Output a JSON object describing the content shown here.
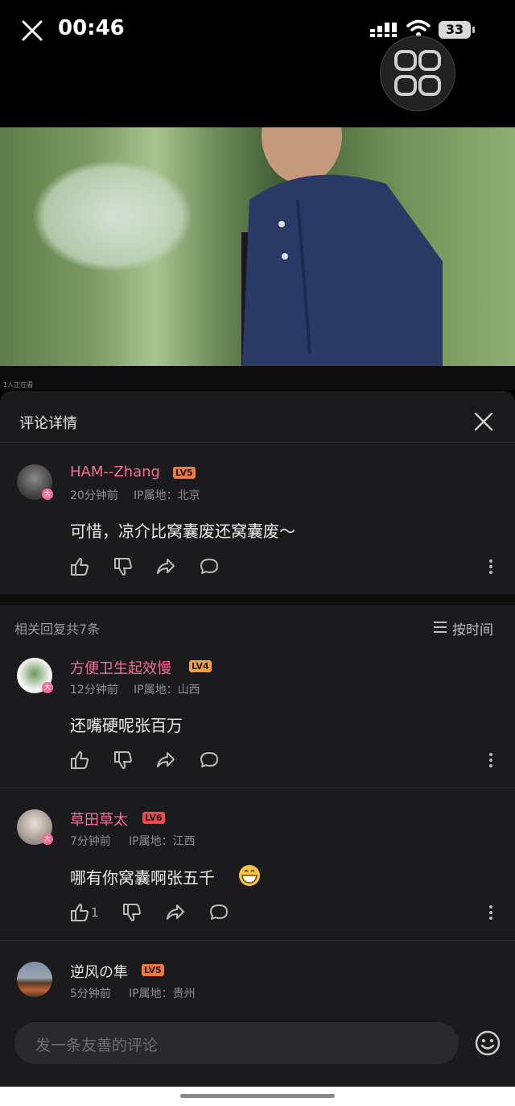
{
  "status": {
    "time": "00:46",
    "battery": "33"
  },
  "video": {
    "viewers": "1人正在看"
  },
  "panel": {
    "title": "评论详情"
  },
  "main_comment": {
    "user": "HAM--Zhang",
    "level": "LV5",
    "level_color": "#f0783c",
    "time": "20分钟前",
    "ip": "IP属地：北京",
    "text": "可惜，凉介比窝囊废还窝囊废～"
  },
  "replies_header": {
    "label": "相关回复共7条",
    "sort": "按时间"
  },
  "replies": [
    {
      "user": "方便卫生起效慢",
      "level": "LV4",
      "level_color": "#f0a040",
      "time": "12分钟前",
      "ip": "IP属地：山西",
      "text": "还嘴硬呢张百万",
      "likes": ""
    },
    {
      "user": "草田草太",
      "level": "LV6",
      "level_color": "#f04a4a",
      "time": "7分钟前",
      "ip": "IP属地：江西",
      "text": "哪有你窝囊啊张五千",
      "likes": "1"
    },
    {
      "user": "逆风の隼",
      "level": "LV5",
      "level_color": "#f0783c",
      "time": "5分钟前",
      "ip": "IP属地：贵州",
      "text": "",
      "likes": ""
    }
  ],
  "input": {
    "placeholder": "发一条友善的评论"
  },
  "icons": [
    "close-icon",
    "signal-icon",
    "wifi-icon",
    "battery-icon",
    "floating-window-icon",
    "like-icon",
    "dislike-icon",
    "share-icon",
    "reply-icon",
    "more-icon",
    "sort-icon",
    "emoji-icon"
  ]
}
